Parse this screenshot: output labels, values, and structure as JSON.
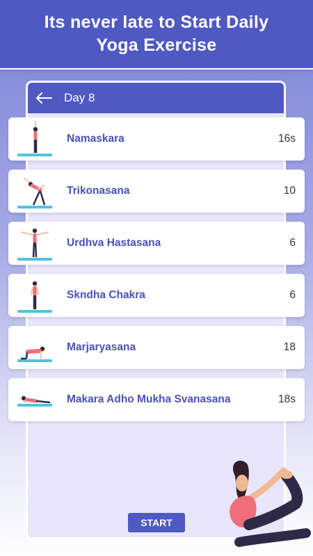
{
  "banner": {
    "title": "Its never late to Start Daily Yoga Exercise"
  },
  "appbar": {
    "back_icon": "arrow-left-icon",
    "title": "Day 8"
  },
  "exercises": [
    {
      "name": "Namaskara",
      "value": "16s",
      "pose": "standing-arms-up"
    },
    {
      "name": "Trikonasana",
      "value": "10",
      "pose": "side-bend"
    },
    {
      "name": "Urdhva Hastasana",
      "value": "6",
      "pose": "arms-out"
    },
    {
      "name": "Skndha Chakra",
      "value": "6",
      "pose": "standing"
    },
    {
      "name": "Marjaryasana",
      "value": "18",
      "pose": "all-fours"
    },
    {
      "name": "Makara Adho Mukha Svanasana",
      "value": "18s",
      "pose": "plank"
    }
  ],
  "start_button": {
    "label": "START"
  },
  "colors": {
    "primary": "#4f59c2",
    "accent_text": "#4a51b3",
    "mat": "#4fc3e0",
    "shirt": "#ec6f7a"
  }
}
